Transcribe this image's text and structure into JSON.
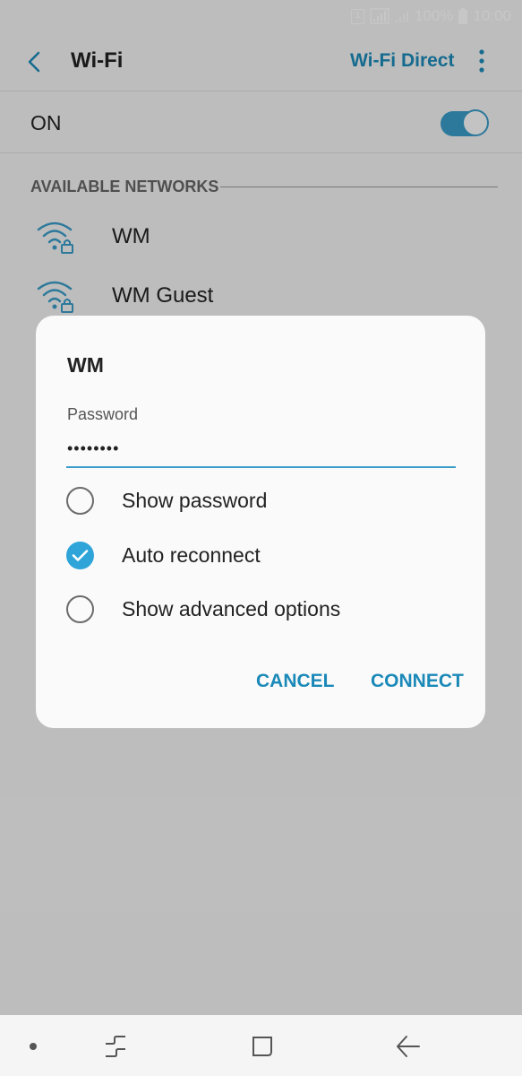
{
  "status_bar": {
    "sim_badge": "1",
    "battery_percent": "100%",
    "time": "10:00"
  },
  "app_bar": {
    "title": "Wi-Fi",
    "wifi_direct_label": "Wi-Fi Direct"
  },
  "wifi_toggle": {
    "label": "ON",
    "enabled": true
  },
  "networks": {
    "section_header": "AVAILABLE NETWORKS",
    "items": [
      {
        "name": "WM",
        "secured": true
      },
      {
        "name": "WM Guest",
        "secured": true
      }
    ]
  },
  "dialog": {
    "title": "WM",
    "password_label": "Password",
    "password_value": "••••••••",
    "options": [
      {
        "label": "Show password",
        "checked": false
      },
      {
        "label": "Auto reconnect",
        "checked": true
      },
      {
        "label": "Show advanced options",
        "checked": false
      }
    ],
    "cancel_label": "CANCEL",
    "connect_label": "CONNECT"
  },
  "colors": {
    "accent": "#1b89b8",
    "toggle_on": "#3a9bc7",
    "checkbox_checked": "#2ea4d9"
  }
}
